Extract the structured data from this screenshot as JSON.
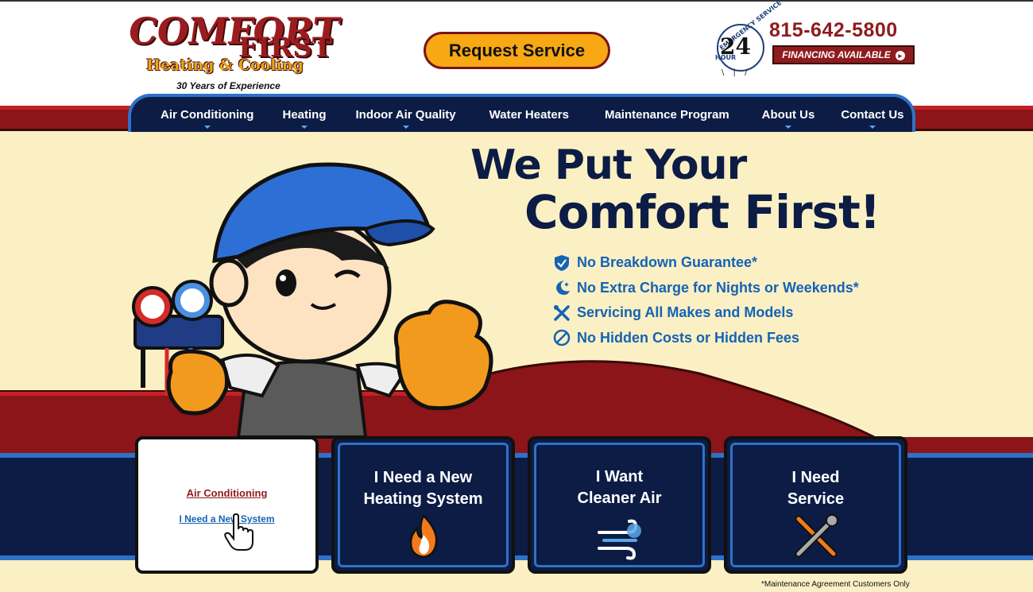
{
  "header": {
    "logo": {
      "word1": "COMFORT",
      "word2": "FIRST",
      "tagline": "Heating & Cooling",
      "years": "30 Years of Experience"
    },
    "request_button": "Request Service",
    "emergency_badge": {
      "number": "24",
      "arc_text": "EMERGENCY SERVICE",
      "hour": "HOUR"
    },
    "phone": "815-642-5800",
    "financing_button": "FINANCING AVAILABLE"
  },
  "nav": {
    "items": [
      {
        "label": "Air Conditioning",
        "has_dropdown": true
      },
      {
        "label": "Heating",
        "has_dropdown": true
      },
      {
        "label": "Indoor Air Quality",
        "has_dropdown": true
      },
      {
        "label": "Water Heaters",
        "has_dropdown": false
      },
      {
        "label": "Maintenance Program",
        "has_dropdown": false
      },
      {
        "label": "About Us",
        "has_dropdown": true
      },
      {
        "label": "Contact Us",
        "has_dropdown": true
      }
    ]
  },
  "hero": {
    "title_line1": "We Put Your",
    "title_line2": "Comfort First!",
    "bullets": [
      {
        "icon": "shield-check-icon",
        "text": "No Breakdown Guarantee*"
      },
      {
        "icon": "moon-icon",
        "text": "No Extra Charge for Nights or Weekends*"
      },
      {
        "icon": "tools-icon",
        "text": "Servicing All Makes and Models"
      },
      {
        "icon": "no-sign-icon",
        "text": "No Hidden Costs or Hidden Fees"
      }
    ]
  },
  "cards": [
    {
      "state": "hovered",
      "link_category": "Air Conditioning",
      "link_item": "I Need a New System"
    },
    {
      "line1": "I Need a New",
      "line2": "Heating System",
      "icon": "flame-icon"
    },
    {
      "line1": "I Want",
      "line2": "Cleaner Air",
      "icon": "wind-icon"
    },
    {
      "line1": "I Need",
      "line2": "Service",
      "icon": "wrench-screwdriver-icon"
    }
  ],
  "footnote": "*Maintenance Agreement Customers Only",
  "colors": {
    "navy": "#0c1c45",
    "blue": "#2e72c8",
    "red": "#8e1b1d",
    "orange": "#f7a813",
    "cream": "#fbf0c4",
    "link_blue": "#1463b5"
  }
}
